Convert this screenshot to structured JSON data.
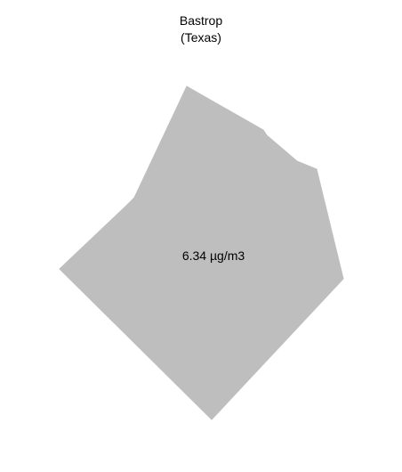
{
  "map": {
    "region_name": "Bastrop",
    "state_name": "(Texas)",
    "value_label": "6.34 µg/m3",
    "fill_color": "#bebebe",
    "background_color": "#ffffff"
  }
}
